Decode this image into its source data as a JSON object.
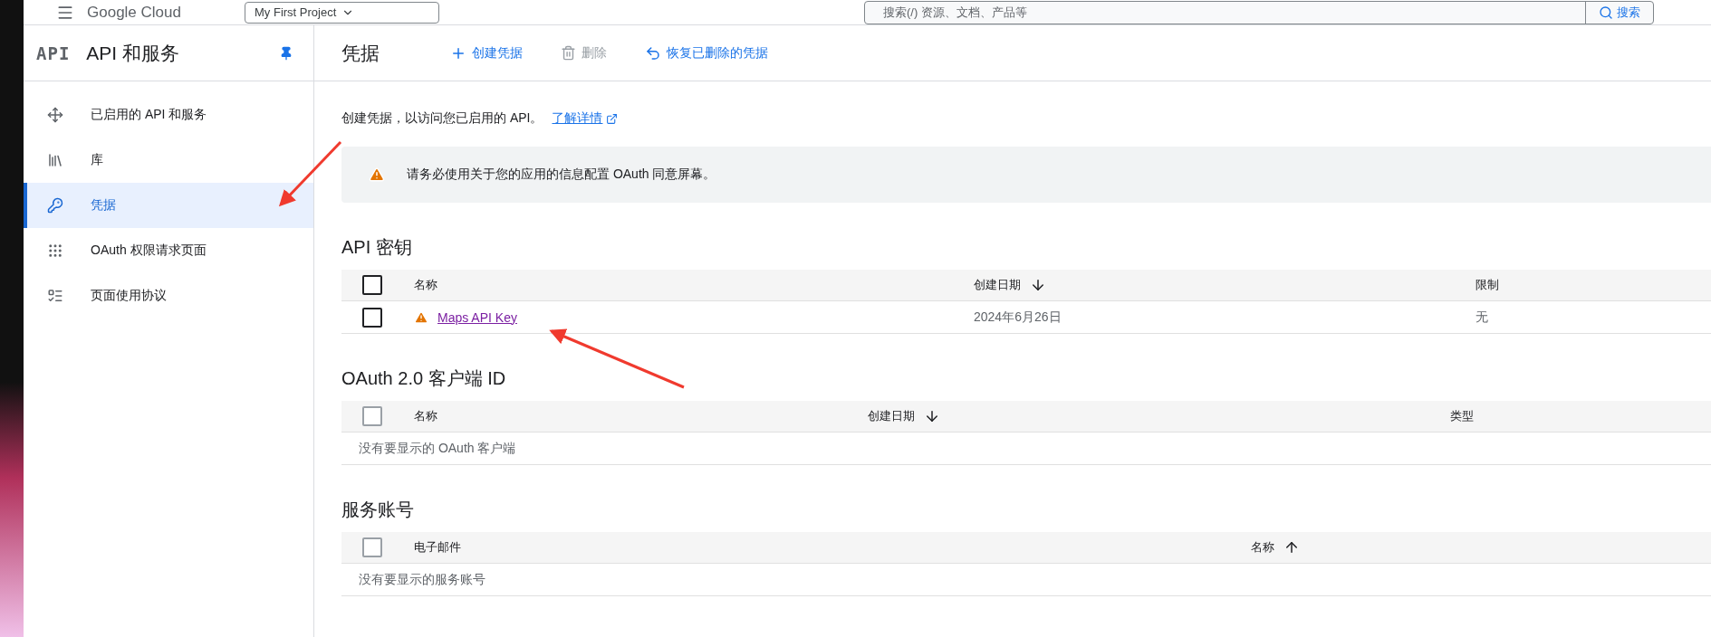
{
  "header": {
    "logo": "Google Cloud",
    "project": "My First Project",
    "search": {
      "placeholder": "搜索(/) 资源、文档、产品等"
    },
    "search_button": "搜索"
  },
  "sidebar": {
    "logo": "API",
    "title": "API 和服务",
    "items": [
      {
        "label": "已启用的 API 和服务",
        "selected": false
      },
      {
        "label": "库",
        "selected": false
      },
      {
        "label": "凭据",
        "selected": true
      },
      {
        "label": "OAuth 权限请求页面",
        "selected": false
      },
      {
        "label": "页面使用协议",
        "selected": false
      }
    ]
  },
  "toolbar": {
    "title": "凭据",
    "actions": [
      {
        "label": "创建凭据",
        "disabled": false
      },
      {
        "label": "删除",
        "disabled": true
      },
      {
        "label": "恢复已删除的凭据",
        "disabled": false
      }
    ]
  },
  "intro": {
    "text": "创建凭据，以访问您已启用的 API。",
    "link": "了解详情"
  },
  "banner": {
    "text": "请务必使用关于您的应用的信息配置 OAuth 同意屏幕。"
  },
  "sections": [
    {
      "title": "API 密钥",
      "columns": [
        {
          "label": "名称",
          "kind": "plain"
        },
        {
          "label": "创建日期",
          "kind": "descending"
        },
        {
          "label": "限制",
          "kind": "plain"
        }
      ],
      "select_all": {
        "checked": false,
        "disabled": false
      },
      "rows": [
        {
          "checked": false,
          "warning": true,
          "cells": [
            "Maps API Key",
            "2024年6月26日",
            "无"
          ]
        }
      ]
    },
    {
      "title": "OAuth 2.0 客户端 ID",
      "columns": [
        {
          "label": "名称",
          "kind": "plain"
        },
        {
          "label": "创建日期",
          "kind": "descending"
        },
        {
          "label": "类型",
          "kind": "plain"
        }
      ],
      "select_all": {
        "checked": false,
        "disabled": true
      },
      "empty": "没有要显示的 OAuth 客户端"
    },
    {
      "title": "服务账号",
      "columns": [
        {
          "label": "电子邮件",
          "kind": "plain"
        },
        {
          "label": "名称",
          "kind": "ascending"
        }
      ],
      "select_all": {
        "checked": false,
        "disabled": true
      },
      "empty": "没有要显示的服务账号"
    }
  ]
}
